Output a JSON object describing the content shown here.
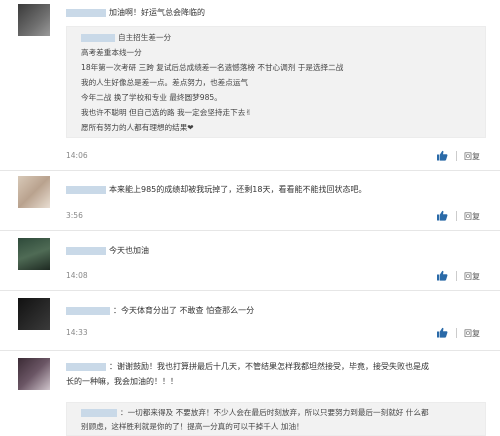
{
  "comments": [
    {
      "text": "加油啊！好运气总会降临的",
      "quote_lines": [
        "自主招生差一分",
        "高考差重本线一分",
        "18年第一次考研 三跨 复试后总成绩差一名遗憾落榜 不甘心调剂 于是选择二战",
        "我的人生好像总是差一点。差点努力，也差点运气",
        "今年二战 换了学校和专业 最终圆梦985。",
        "我也许不聪明 但自己选的路 我一定会坚持走下去✌",
        "愿所有努力的人都有理想的结果❤"
      ],
      "time": "14:06",
      "reply": "回复"
    },
    {
      "text": "本来能上985的成绩却被我玩掉了，还剩18天，看看能不能找回状态吧。",
      "time": "3:56",
      "reply": "回复"
    },
    {
      "text": "今天也加油",
      "time": "14:08",
      "reply": "回复"
    },
    {
      "text": "：今天体育分出了 不敢查 怕查那么一分",
      "time": "14:33",
      "reply": "回复"
    },
    {
      "text_lines": [
        "：谢谢鼓励！我也打算拼最后十几天，不管结果怎样我都坦然接受，毕竟，接受失败也是成",
        "长的一种嘛，我会加油的！！！"
      ],
      "quote_lines": [
        "：一切都来得及 不要放弃！不少人会在最后时刻放弃，所以只要努力到最后一刻就好 什么都",
        "别顾虑，这样胜利就是你的了！提高一分真的可以干掉千人 加油！"
      ],
      "reply": "回复"
    }
  ],
  "colors": {
    "link_blue": "#2a6aa8",
    "masked_name": "#c9d9e8",
    "quote_bg": "#f2f2f2"
  },
  "icons": {
    "like": "thumbs-up-icon"
  }
}
